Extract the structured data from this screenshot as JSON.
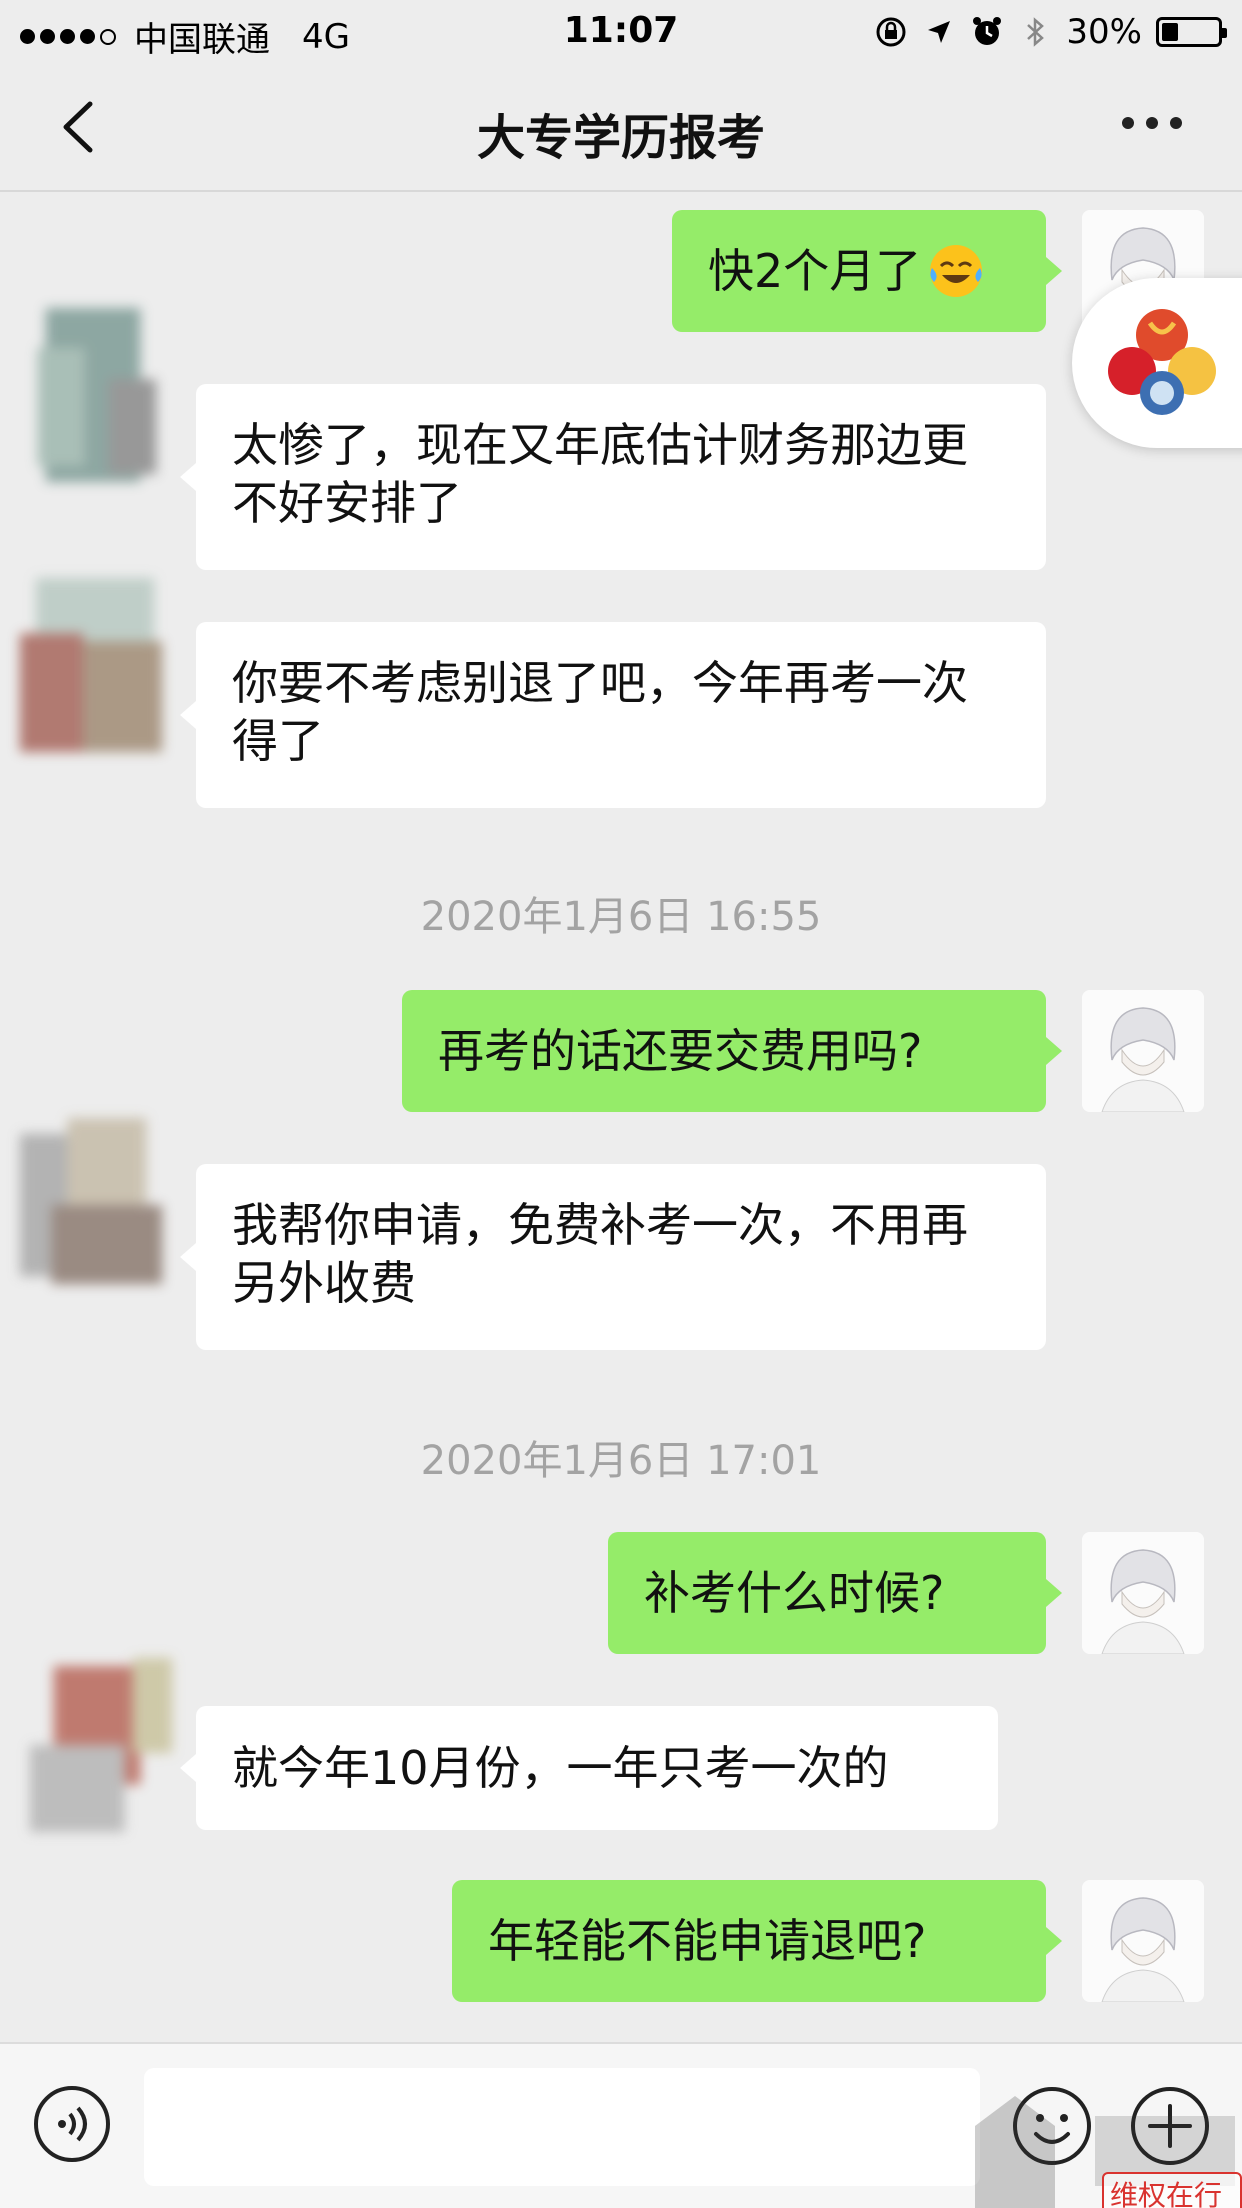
{
  "status_bar": {
    "carrier": "中国联通",
    "network": "4G",
    "time": "11:07",
    "battery_percent": "30%",
    "battery_level": 0.3
  },
  "nav": {
    "title": "大专学历报考"
  },
  "messages": [
    {
      "sender": "me",
      "text": "快2个月了",
      "emoji": "face-with-tears-of-joy"
    },
    {
      "sender": "other",
      "text": "太惨了，现在又年底估计财务那边更不好安排了"
    },
    {
      "sender": "other",
      "text": "你要不考虑别退了吧，今年再考一次得了"
    },
    {
      "sender": "timestamp",
      "text": "2020年1月6日 16:55"
    },
    {
      "sender": "me",
      "text": "再考的话还要交费用吗?"
    },
    {
      "sender": "other",
      "text": "我帮你申请，免费补考一次，不用再另外收费"
    },
    {
      "sender": "timestamp",
      "text": "2020年1月6日 17:01"
    },
    {
      "sender": "me",
      "text": "补考什么时候?"
    },
    {
      "sender": "other",
      "text": "就今年10月份，一年只考一次的"
    },
    {
      "sender": "me",
      "text": "年轻能不能申请退吧?"
    }
  ],
  "input": {
    "value": ""
  },
  "icons": {
    "back": "chevron-left-icon",
    "more": "more-dots-icon",
    "voice": "voice-icon",
    "emoji": "emoji-icon",
    "plus": "plus-icon"
  },
  "colors": {
    "outgoing_bubble": "#95ec69",
    "incoming_bubble": "#ffffff",
    "background": "#ededed",
    "timestamp": "#a3a3a3"
  },
  "watermark": {
    "text": "维权在行动"
  }
}
